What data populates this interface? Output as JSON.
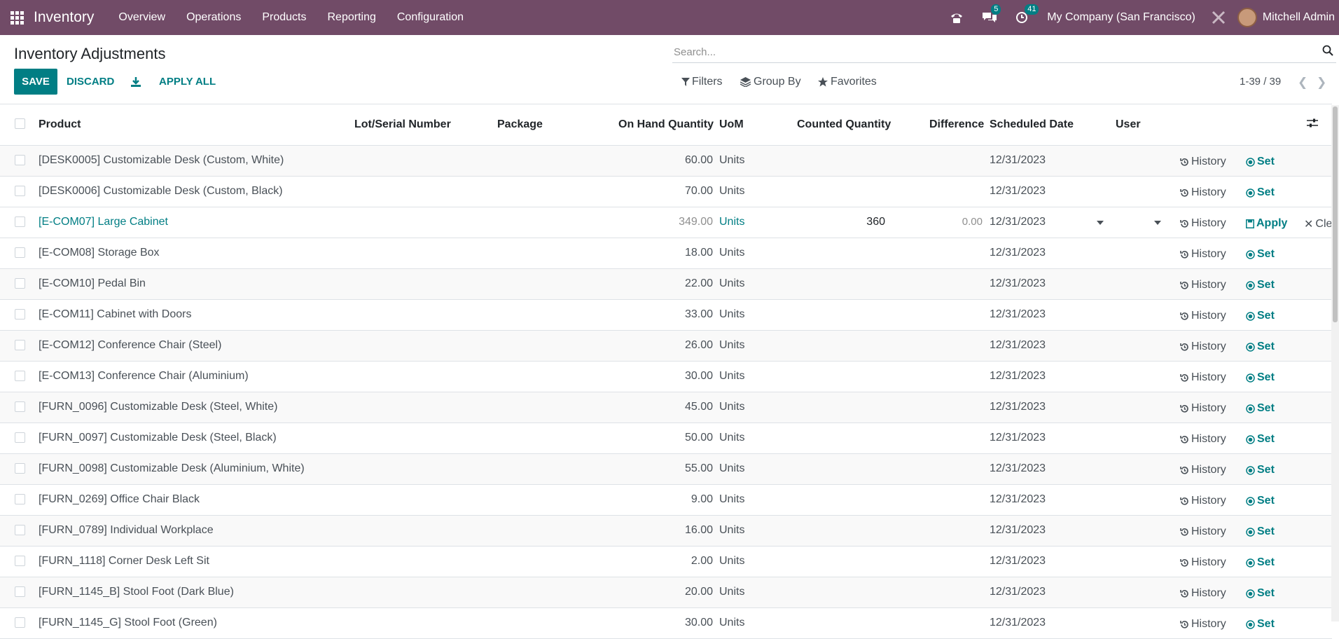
{
  "navbar": {
    "app_name": "Inventory",
    "menu": [
      "Overview",
      "Operations",
      "Products",
      "Reporting",
      "Configuration"
    ],
    "messages_badge": "5",
    "activities_badge": "41",
    "company": "My Company (San Francisco)",
    "user": "Mitchell Admin"
  },
  "control": {
    "title": "Inventory Adjustments",
    "save": "SAVE",
    "discard": "DISCARD",
    "apply_all": "APPLY ALL",
    "search_placeholder": "Search...",
    "filters": "Filters",
    "group_by": "Group By",
    "favorites": "Favorites",
    "pager": "1-39 / 39"
  },
  "columns": {
    "product": "Product",
    "lot": "Lot/Serial Number",
    "package": "Package",
    "on_hand": "On Hand Quantity",
    "uom": "UoM",
    "counted": "Counted Quantity",
    "difference": "Difference",
    "scheduled": "Scheduled Date",
    "user": "User"
  },
  "actions": {
    "history": "History",
    "set": "Set",
    "apply": "Apply",
    "clear": "Cle"
  },
  "rows": [
    {
      "product": "[DESK0005] Customizable Desk (Custom, White)",
      "on_hand": "60.00",
      "uom": "Units",
      "date": "12/31/2023"
    },
    {
      "product": "[DESK0006] Customizable Desk (Custom, Black)",
      "on_hand": "70.00",
      "uom": "Units",
      "date": "12/31/2023"
    },
    {
      "product": "[E-COM07] Large Cabinet",
      "on_hand": "349.00",
      "uom": "Units",
      "counted": "360",
      "difference": "0.00",
      "date": "12/31/2023"
    },
    {
      "product": "[E-COM08] Storage Box",
      "on_hand": "18.00",
      "uom": "Units",
      "date": "12/31/2023"
    },
    {
      "product": "[E-COM10] Pedal Bin",
      "on_hand": "22.00",
      "uom": "Units",
      "date": "12/31/2023"
    },
    {
      "product": "[E-COM11] Cabinet with Doors",
      "on_hand": "33.00",
      "uom": "Units",
      "date": "12/31/2023"
    },
    {
      "product": "[E-COM12] Conference Chair (Steel)",
      "on_hand": "26.00",
      "uom": "Units",
      "date": "12/31/2023"
    },
    {
      "product": "[E-COM13] Conference Chair (Aluminium)",
      "on_hand": "30.00",
      "uom": "Units",
      "date": "12/31/2023"
    },
    {
      "product": "[FURN_0096] Customizable Desk (Steel, White)",
      "on_hand": "45.00",
      "uom": "Units",
      "date": "12/31/2023"
    },
    {
      "product": "[FURN_0097] Customizable Desk (Steel, Black)",
      "on_hand": "50.00",
      "uom": "Units",
      "date": "12/31/2023"
    },
    {
      "product": "[FURN_0098] Customizable Desk (Aluminium, White)",
      "on_hand": "55.00",
      "uom": "Units",
      "date": "12/31/2023"
    },
    {
      "product": "[FURN_0269] Office Chair Black",
      "on_hand": "9.00",
      "uom": "Units",
      "date": "12/31/2023"
    },
    {
      "product": "[FURN_0789] Individual Workplace",
      "on_hand": "16.00",
      "uom": "Units",
      "date": "12/31/2023"
    },
    {
      "product": "[FURN_1118] Corner Desk Left Sit",
      "on_hand": "2.00",
      "uom": "Units",
      "date": "12/31/2023"
    },
    {
      "product": "[FURN_1145_B] Stool Foot (Dark Blue)",
      "on_hand": "20.00",
      "uom": "Units",
      "date": "12/31/2023"
    },
    {
      "product": "[FURN_1145_G] Stool Foot (Green)",
      "on_hand": "30.00",
      "uom": "Units",
      "date": "12/31/2023"
    }
  ],
  "colors": {
    "navbar": "#714B67",
    "primary": "#017E84"
  }
}
